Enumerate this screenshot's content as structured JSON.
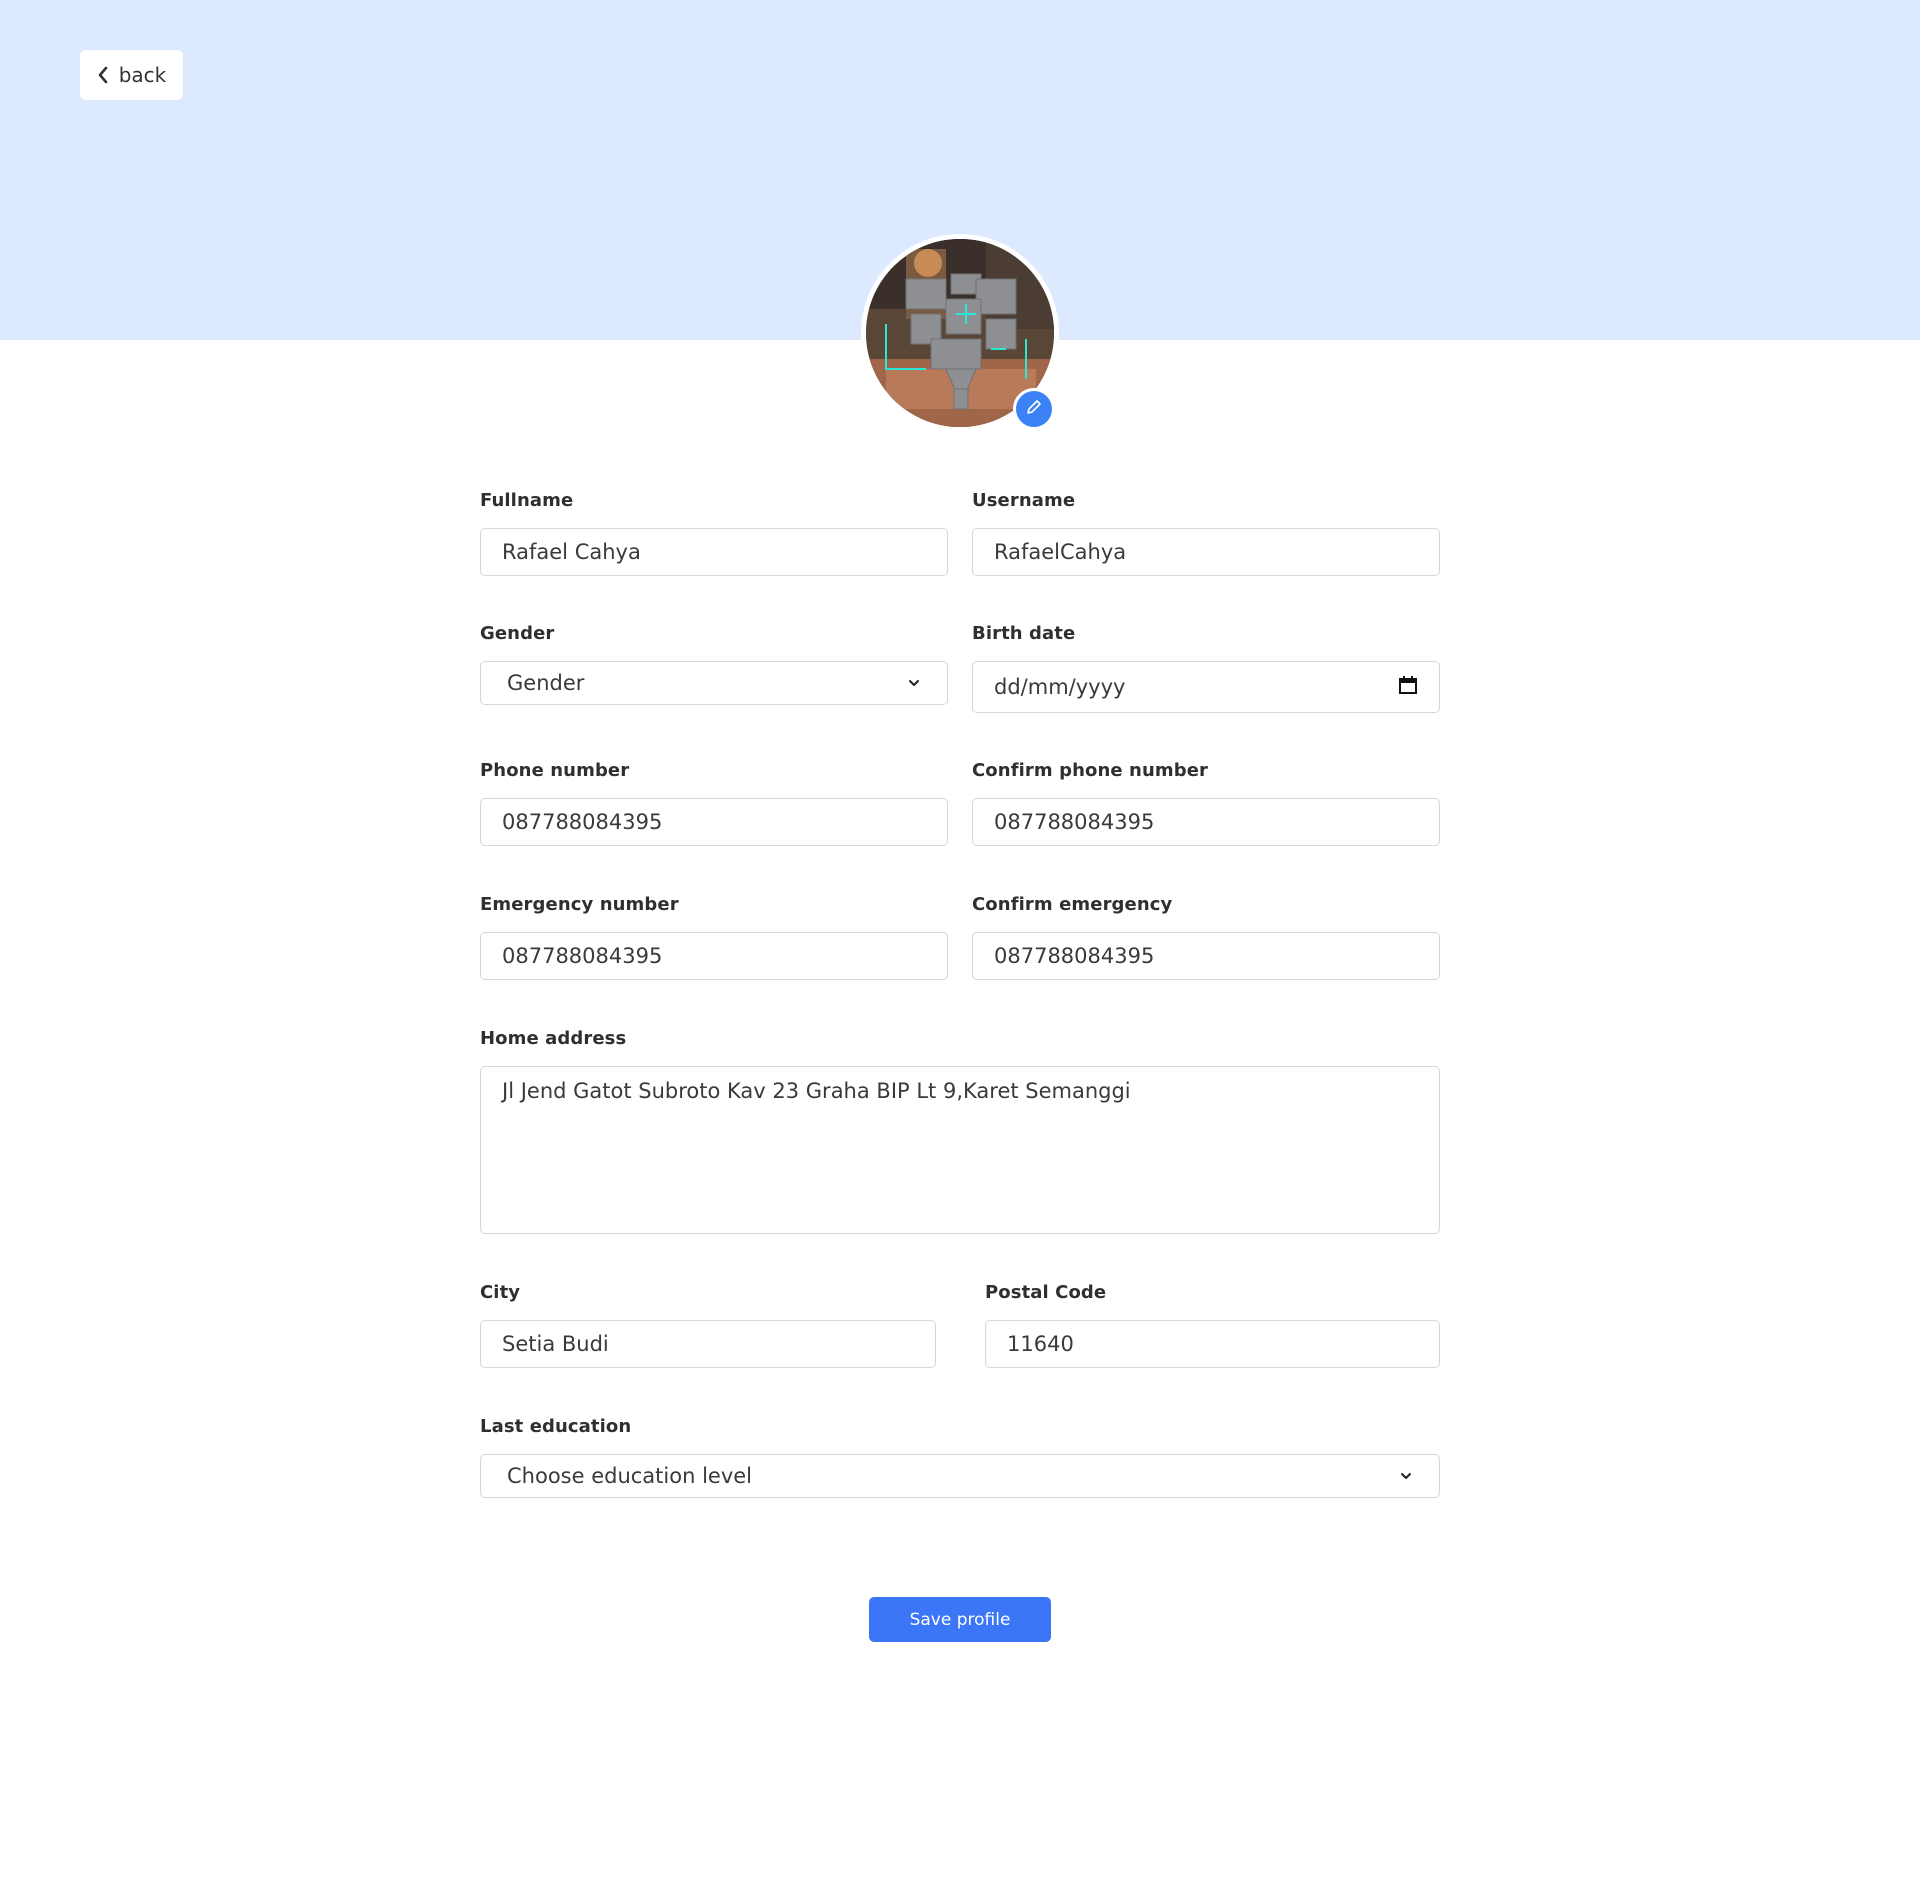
{
  "header": {
    "back_label": "back"
  },
  "profile": {
    "avatar_alt": "profile picture",
    "edit_icon": "pencil-icon"
  },
  "form": {
    "fullname": {
      "label": "Fullname",
      "value": "Rafael Cahya"
    },
    "username": {
      "label": "Username",
      "value": "RafaelCahya"
    },
    "gender": {
      "label": "Gender",
      "selected": "Gender"
    },
    "birth_date": {
      "label": "Birth date",
      "placeholder": "dd/mm/yyyy"
    },
    "phone": {
      "label": "Phone number",
      "value": "087788084395"
    },
    "confirm_phone": {
      "label": "Confirm phone number",
      "value": "087788084395"
    },
    "emergency": {
      "label": "Emergency number",
      "value": "087788084395"
    },
    "confirm_emergency": {
      "label": "Confirm emergency",
      "value": "087788084395"
    },
    "address": {
      "label": "Home address",
      "value": "Jl Jend Gatot Subroto Kav 23 Graha BIP Lt 9,Karet Semanggi"
    },
    "city": {
      "label": "City",
      "value": "Setia Budi"
    },
    "postal_code": {
      "label": "Postal Code",
      "value": "11640"
    },
    "education": {
      "label": "Last education",
      "selected": "Choose education level"
    }
  },
  "actions": {
    "save_label": "Save profile"
  },
  "colors": {
    "header_bg": "#dce9fe",
    "primary": "#3b76f6"
  }
}
